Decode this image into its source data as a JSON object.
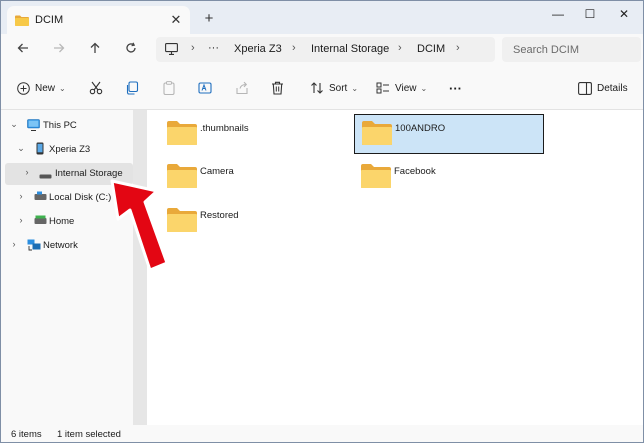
{
  "window": {
    "tab_title": "DCIM",
    "tab_close": "✕",
    "new_tab": "+",
    "minimize": "—",
    "maximize": "☐",
    "close": "✕"
  },
  "address": {
    "more": "···",
    "breadcrumbs": [
      "Xperia Z3",
      "Internal Storage",
      "DCIM"
    ],
    "separator": "›",
    "search_placeholder": "Search DCIM"
  },
  "toolbar": {
    "new_label": "New",
    "sort_label": "Sort",
    "view_label": "View",
    "more_label": "···",
    "details_label": "Details",
    "chevron": "⌄"
  },
  "navigation": {
    "expanded": "⌄",
    "collapsed": "›",
    "items": [
      {
        "label": "This PC",
        "icon": "monitor-icon"
      },
      {
        "label": "Xperia Z3",
        "icon": "phone-icon"
      },
      {
        "label": "Internal Storage",
        "icon": "storage-icon"
      },
      {
        "label": "Local Disk (C:)",
        "icon": "drive-icon"
      },
      {
        "label": "Home",
        "icon": "drive-icon"
      },
      {
        "label": "Network",
        "icon": "network-icon"
      }
    ]
  },
  "folders": [
    {
      "name": ".thumbnails",
      "selected": false
    },
    {
      "name": "100ANDRO",
      "selected": true
    },
    {
      "name": "Camera",
      "selected": false
    },
    {
      "name": "Facebook",
      "selected": false
    },
    {
      "name": "Restored",
      "selected": false
    }
  ],
  "status": {
    "item_count": "6 items",
    "selection": "1 item selected"
  },
  "colors": {
    "selection_bg": "#cce4f7",
    "folder_yellow": "#f7c948",
    "arrow_red": "#e30613"
  }
}
